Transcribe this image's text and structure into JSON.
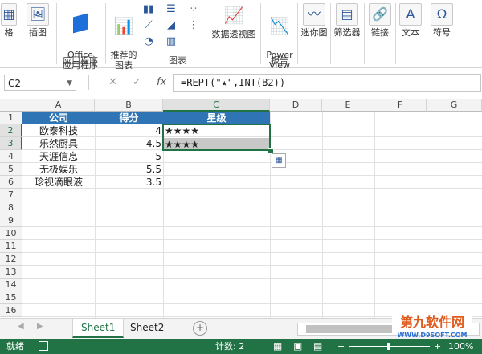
{
  "ribbon": {
    "buttons": [
      {
        "label": "格",
        "icon": "table-icon"
      },
      {
        "label": "插图",
        "icon": "illustrations-icon"
      },
      {
        "label": "Office\n应用程序",
        "icon": "office-apps-icon"
      },
      {
        "label": "推荐的\n图表",
        "icon": "recommended-charts-icon"
      },
      {
        "label": "数据透视图",
        "icon": "pivot-chart-icon"
      },
      {
        "label": "Power\nView",
        "icon": "power-view-icon"
      },
      {
        "label": "迷你图",
        "icon": "sparklines-icon"
      },
      {
        "label": "筛选器",
        "icon": "filter-icon"
      },
      {
        "label": "链接",
        "icon": "link-icon"
      },
      {
        "label": "文本",
        "icon": "text-icon"
      },
      {
        "label": "符号",
        "icon": "symbol-icon"
      }
    ],
    "groups": {
      "apps": "应用程序",
      "charts": "图表",
      "reports": "报告"
    }
  },
  "formula_bar": {
    "name_box": "C2",
    "formula": "=REPT(\"★\",INT(B2))",
    "cancel_glyph": "✕",
    "enter_glyph": "✓",
    "fx_glyph": "fx"
  },
  "sheet": {
    "columns": [
      "A",
      "B",
      "C",
      "D",
      "E",
      "F",
      "G"
    ],
    "rows": [
      "1",
      "2",
      "3",
      "4",
      "5",
      "6",
      "7",
      "8",
      "9",
      "10",
      "11",
      "12",
      "13",
      "14",
      "15",
      "16"
    ],
    "headers": [
      "公司",
      "得分",
      "星级"
    ],
    "data": [
      {
        "company": "欧泰科技",
        "score": "4",
        "stars": "★★★★"
      },
      {
        "company": "乐然厨具",
        "score": "4.5",
        "stars": "★★★★"
      },
      {
        "company": "天涯信息",
        "score": "5",
        "stars": ""
      },
      {
        "company": "无极娱乐",
        "score": "5.5",
        "stars": ""
      },
      {
        "company": "珍视滴眼液",
        "score": "3.5",
        "stars": ""
      }
    ],
    "accent_color": "#217346",
    "header_fill": "#2f75b5"
  },
  "tabs": [
    "Sheet1",
    "Sheet2"
  ],
  "status_bar": {
    "ready": "就绪",
    "count": "计数: 2",
    "zoom": "100%"
  },
  "watermark": {
    "text": "WWW.D9SOFT.COM"
  }
}
